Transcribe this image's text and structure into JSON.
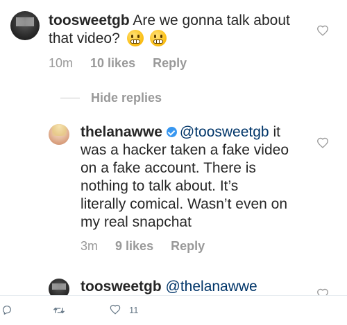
{
  "comments": [
    {
      "username": "toosweetgb",
      "text": "Are we gonna talk about that video?",
      "emoji": [
        "grimacing-face-emoji",
        "grimacing-face-emoji"
      ],
      "time": "10m",
      "likes": "10 likes",
      "reply": "Reply"
    }
  ],
  "hide_replies": "Hide replies",
  "replies": [
    {
      "username": "thelanawwe",
      "verified": true,
      "mention": "@toosweetgb",
      "text_line1_suffix": " it",
      "lines": [
        "was a hacker taken a fake video",
        "on a fake account. There is",
        "nothing to talk about. It’s",
        "literally comical. Wasn’t even on",
        "my real snapchat"
      ],
      "time": "3m",
      "likes": "9 likes",
      "reply": "Reply"
    },
    {
      "username": "toosweetgb",
      "mention": "@thelanawwe"
    }
  ],
  "bottom_bar": {
    "retweet_count": "",
    "like_count": "11"
  },
  "colors": {
    "text": "#262626",
    "meta": "#999999",
    "mention": "#003569",
    "verified": "#3897f0",
    "twitter_icon": "#657786"
  }
}
